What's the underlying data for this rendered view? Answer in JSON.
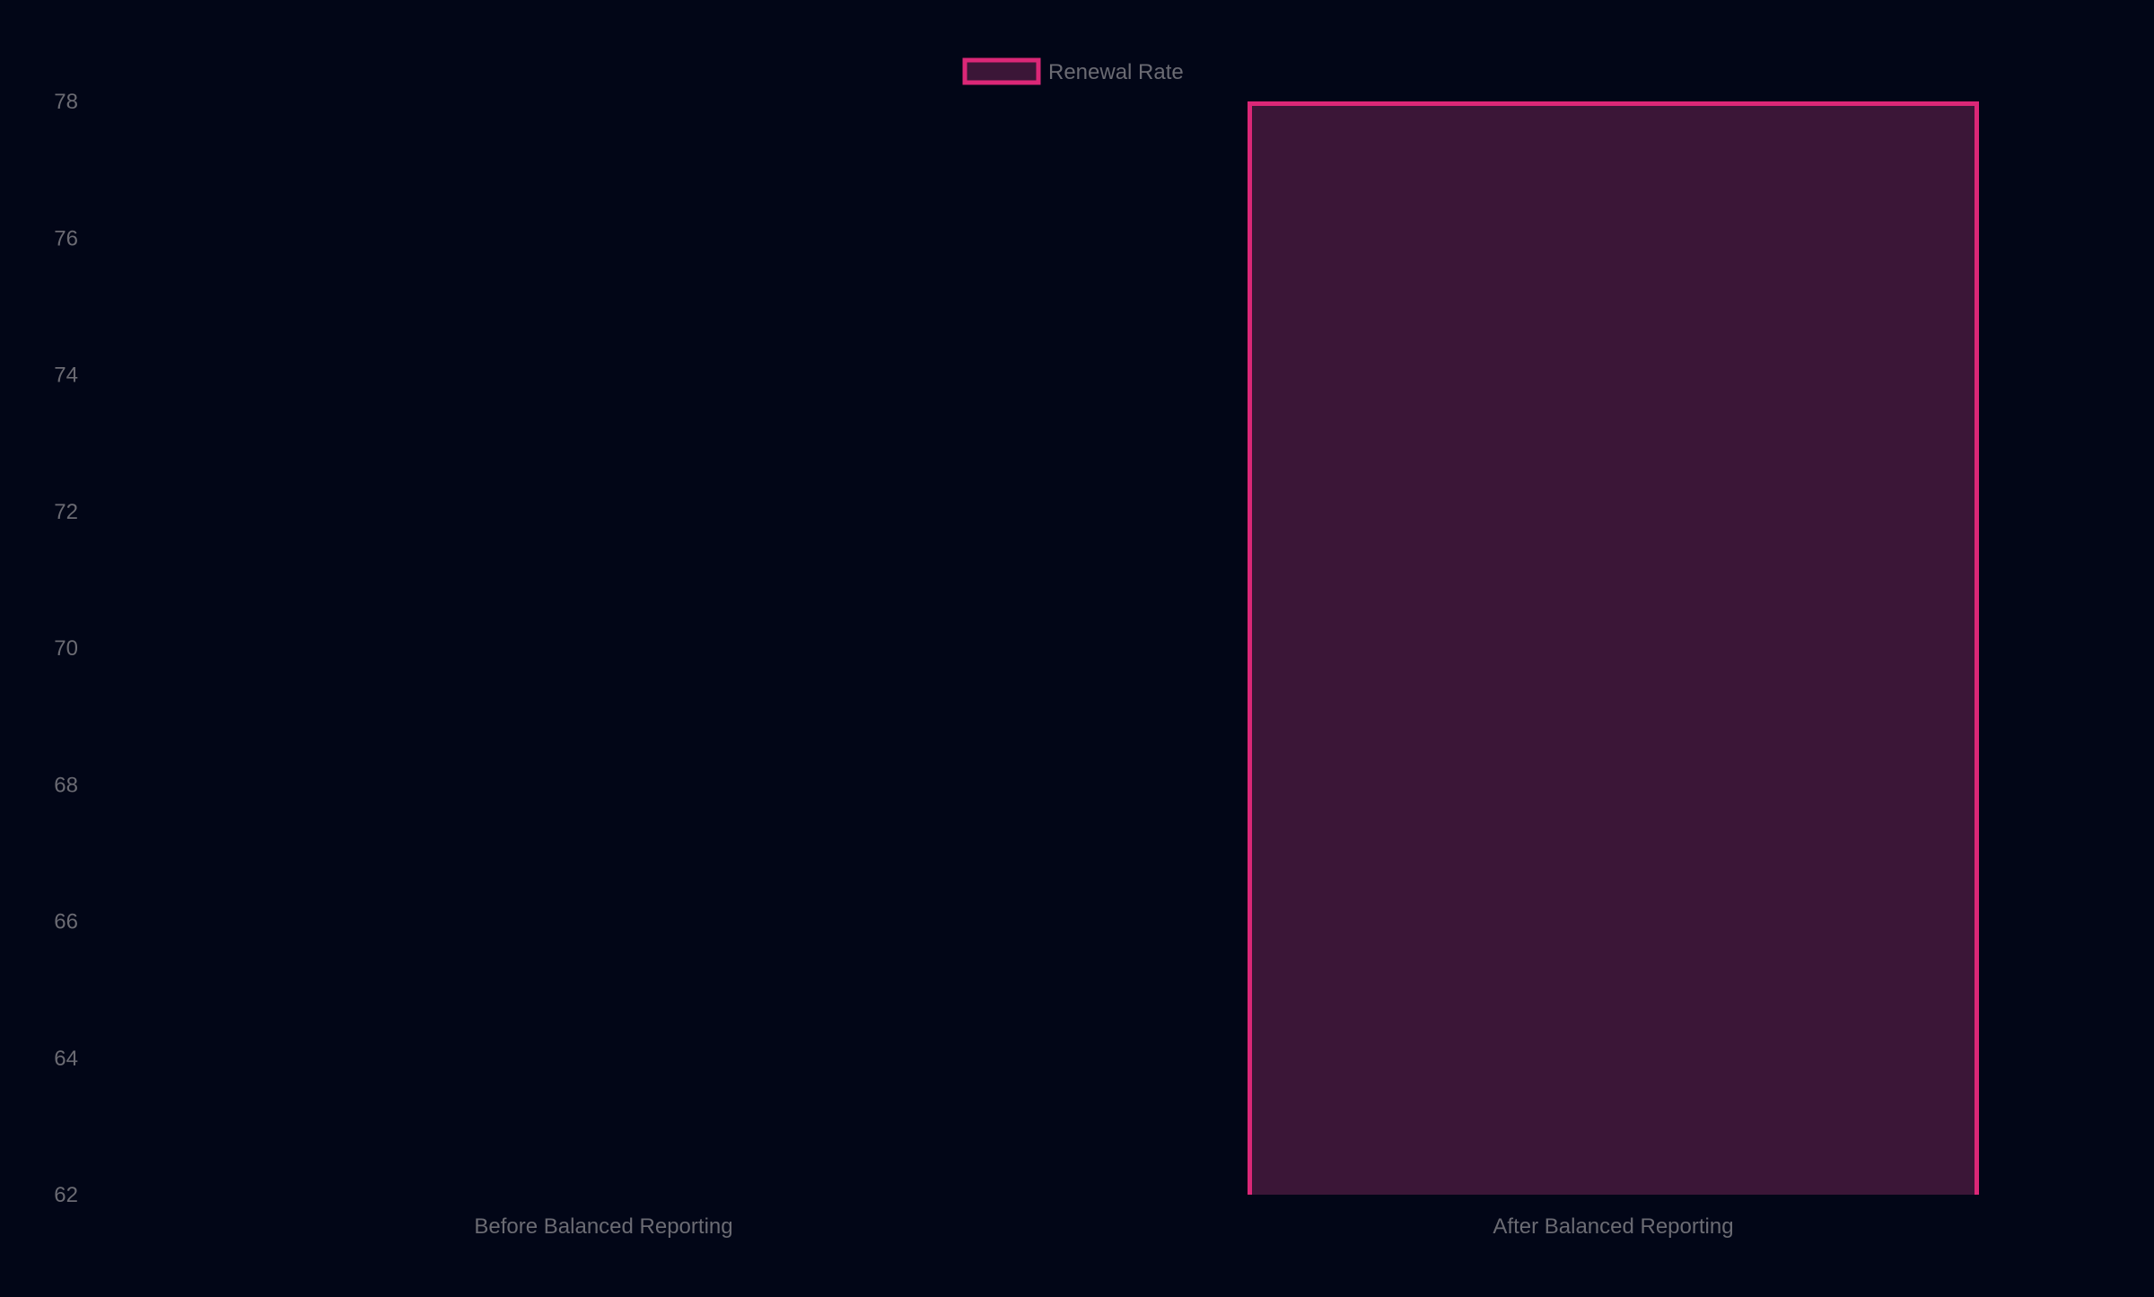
{
  "chart_data": {
    "type": "bar",
    "categories": [
      "Before Balanced Reporting",
      "After Balanced Reporting"
    ],
    "series": [
      {
        "name": "Renewal Rate",
        "values": [
          62,
          78
        ]
      }
    ],
    "ylim": [
      62,
      78
    ],
    "yticks": [
      62,
      64,
      66,
      68,
      70,
      72,
      74,
      76,
      78
    ],
    "grid": false,
    "legend": "top-center",
    "colors": {
      "background": "#020617",
      "bar_stroke": "#db2777",
      "bar_fill": "#3b1637",
      "text": "#6b6b73"
    }
  }
}
